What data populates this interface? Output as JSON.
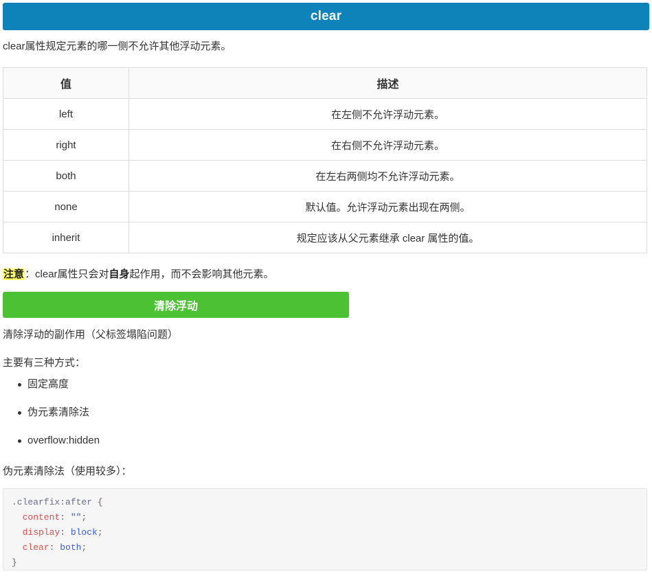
{
  "header": {
    "title": "clear"
  },
  "intro": "clear属性规定元素的哪一侧不允许其他浮动元素。",
  "table": {
    "columns": [
      "值",
      "描述"
    ],
    "rows": [
      {
        "value": "left",
        "description": "在左侧不允许浮动元素。"
      },
      {
        "value": "right",
        "description": "在右侧不允许浮动元素。"
      },
      {
        "value": "both",
        "description": "在左右两侧均不允许浮动元素。"
      },
      {
        "value": "none",
        "description": "默认值。允许浮动元素出现在两侧。"
      },
      {
        "value": "inherit",
        "description": "规定应该从父元素继承 clear 属性的值。"
      }
    ]
  },
  "note": {
    "highlight": "注意",
    "lead": "：clear属性只会对",
    "strong": "自身",
    "tail": "起作用，而不会影响其他元素。"
  },
  "green_button": {
    "label": "清除浮动"
  },
  "paragraphs": {
    "side_effect": "清除浮动的副作用（父标签塌陷问题）",
    "ways_intro": "主要有三种方式：",
    "pseudo_intro": "伪元素清除法（使用较多）："
  },
  "bullets": [
    "固定高度",
    "伪元素清除法",
    "overflow:hidden"
  ],
  "code": {
    "line1_selector": ".clearfix:after",
    "line1_brace": " {",
    "line2_prop": "  content",
    "line2_val": "\"\"",
    "line3_prop": "  display",
    "line3_val": "block",
    "line4_prop": "  clear",
    "line4_val": "both",
    "line5": "}",
    "colon": ": ",
    "semicolon": ";"
  },
  "colors": {
    "header_blue": "#0d83b9",
    "button_green": "#4cc134",
    "highlight_yellow": "#ffff66",
    "code_bg": "#f6f6f6",
    "table_border": "#dddddd"
  }
}
